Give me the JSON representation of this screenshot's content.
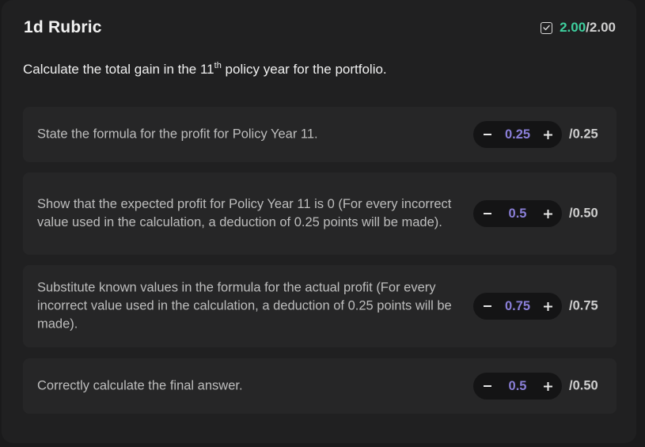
{
  "header": {
    "title": "1d Rubric",
    "score_earned": "2.00",
    "score_separator": "/",
    "score_max": "2.00",
    "score_icon": "checkbox-checked-icon",
    "score_color": "#3ecf9e"
  },
  "question": {
    "prefix": "Calculate the total gain in the 11",
    "superscript": "th",
    "suffix": " policy year for the portfolio."
  },
  "criteria": [
    {
      "text": "State the formula for the profit for Policy Year 11.",
      "value": "0.25",
      "max": "/0.25"
    },
    {
      "text": "Show that the expected profit for Policy Year 11 is 0 (For every incorrect value used in the calculation, a deduction of 0.25 points will be made).",
      "value": "0.5",
      "max": "/0.50"
    },
    {
      "text": "Substitute known values in the formula for the actual profit (For every incorrect value used in the calculation, a deduction of 0.25 points will be made).",
      "value": "0.75",
      "max": "/0.75"
    },
    {
      "text": "Correctly calculate the final answer.",
      "value": "0.5",
      "max": "/0.50"
    }
  ],
  "stepper": {
    "decrement_icon": "minus-icon",
    "increment_icon": "plus-icon",
    "value_color": "#8a7fd8"
  }
}
